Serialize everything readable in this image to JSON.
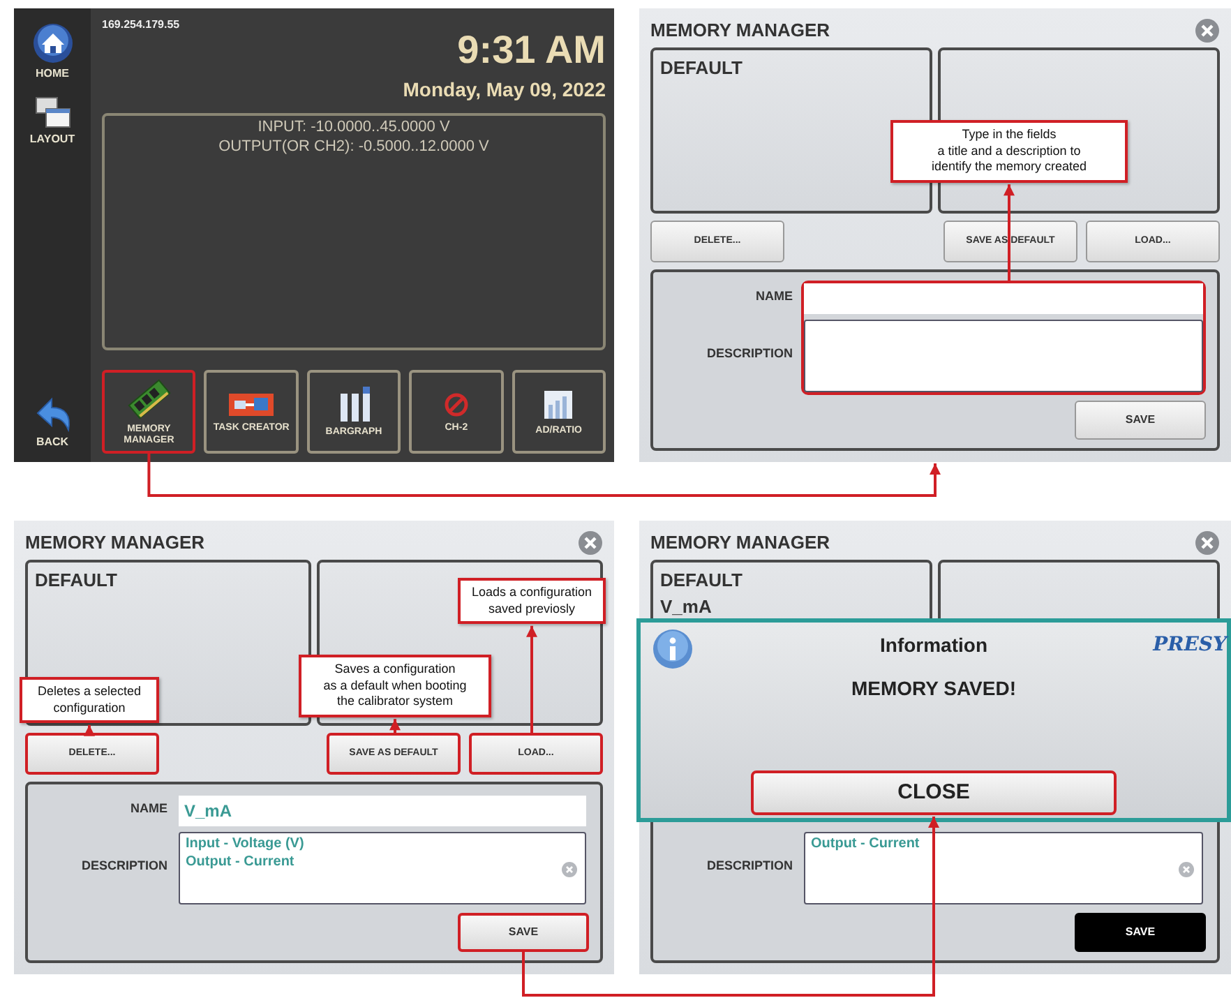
{
  "home_screen": {
    "sidebar": [
      {
        "kind": "home",
        "label": "HOME"
      },
      {
        "kind": "layout",
        "label": "LAYOUT"
      },
      {
        "kind": "back",
        "label": "BACK"
      }
    ],
    "ip": "169.254.179.55",
    "time": "9:31 AM",
    "date": "Monday, May 09, 2022",
    "info_lines": [
      "INPUT: -10.0000..45.0000 V",
      "OUTPUT(OR CH2): -0.5000..12.0000 V"
    ],
    "apps": [
      {
        "kind": "memory",
        "label": "MEMORY MANAGER",
        "highlighted": true
      },
      {
        "kind": "task",
        "label": "TASK CREATOR",
        "highlighted": false
      },
      {
        "kind": "bargraph",
        "label": "BARGRAPH",
        "highlighted": false
      },
      {
        "kind": "ch2",
        "label": "CH-2",
        "highlighted": false
      },
      {
        "kind": "ratio",
        "label": "AD/RATIO",
        "highlighted": false
      }
    ]
  },
  "memory_screens": [
    {
      "title": "MEMORY MANAGER",
      "entries": [
        "DEFAULT"
      ],
      "buttons": [
        {
          "label": "DELETE...",
          "highlighted": false
        },
        {
          "label": "SAVE AS DEFAULT",
          "highlighted": false
        },
        {
          "label": "LOAD...",
          "highlighted": false
        }
      ],
      "name_field": {
        "label": "NAME"
      },
      "description_field": {
        "label": "DESCRIPTION"
      },
      "fields_highlighted": true,
      "save": {
        "label": "SAVE",
        "highlighted": false,
        "pressed": false
      },
      "callouts": [
        {
          "kind": "fields",
          "lines": [
            "Type in the fields",
            "a title and a description to",
            "identify the memory created"
          ]
        }
      ]
    },
    {
      "title": "MEMORY MANAGER",
      "entries": [
        "DEFAULT"
      ],
      "buttons": [
        {
          "label": "DELETE...",
          "highlighted": true
        },
        {
          "label": "SAVE AS DEFAULT",
          "highlighted": true
        },
        {
          "label": "LOAD...",
          "highlighted": true
        }
      ],
      "name_field": {
        "label": "NAME",
        "value": "V_mA"
      },
      "description_field": {
        "label": "DESCRIPTION",
        "lines": [
          "Input - Voltage (V)",
          "Output - Current"
        ],
        "clear_icon": true
      },
      "save": {
        "label": "SAVE",
        "highlighted": true,
        "pressed": false
      },
      "callouts": [
        {
          "kind": "delete",
          "lines": [
            "Deletes a selected",
            "configuration"
          ]
        },
        {
          "kind": "save_default",
          "lines": [
            "Saves a configuration",
            "as a default when booting",
            "the calibrator system"
          ]
        },
        {
          "kind": "load",
          "lines": [
            "Loads a configuration",
            "saved previosly"
          ]
        }
      ]
    },
    {
      "title": "MEMORY MANAGER",
      "entries": [
        "DEFAULT",
        "V_mA"
      ],
      "description_field": {
        "label": "DESCRIPTION",
        "lines": [
          "Output - Current"
        ],
        "clear_icon": true
      },
      "save": {
        "label": "SAVE",
        "highlighted": false,
        "pressed": true
      },
      "dialog": {
        "title": "Information",
        "brand": "PRESY",
        "message": "MEMORY SAVED!",
        "button": {
          "label": "CLOSE",
          "highlighted": true
        }
      }
    }
  ]
}
